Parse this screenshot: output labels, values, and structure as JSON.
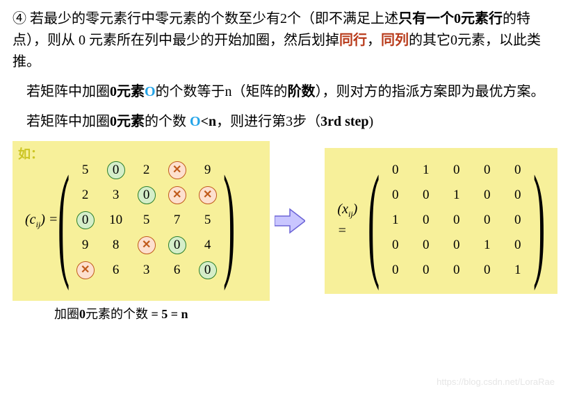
{
  "p1": {
    "num": "④",
    "t1": " 若最少的零元素行中零元素的个数至少有2个（即不满足上述",
    "t2": "只有一个0元素行",
    "t3": "的特点），则从 0 元素所在列中最少的开始加圈，然后划掉",
    "red1": "同行",
    "comma": "，",
    "red2": "同列",
    "t4": "的其它0元素，以此类推。"
  },
  "p2": {
    "indent": "　",
    "t1": "若矩阵中加圈",
    "b0": "0元素",
    "o": "O",
    "t2": "的个数等于n（矩阵的",
    "b1": "阶数",
    "t3": "），则对方的指派方案即为最优方案。"
  },
  "p3": {
    "indent": "　",
    "t1": "若矩阵中加圈",
    "b0": "0元素",
    "t2": "的个数 ",
    "o": "O",
    "lt": "<n",
    "t3": "，则进行第3步（",
    "step": "3rd step",
    "t4": ")"
  },
  "left": {
    "how": "如：",
    "label_pre": "(",
    "label_var": "c",
    "label_sub": "ij",
    "label_post": ") =",
    "cells": [
      {
        "v": "5"
      },
      {
        "v": "0",
        "g": true
      },
      {
        "v": "2"
      },
      {
        "v": "×",
        "x": true
      },
      {
        "v": "9"
      },
      {
        "v": "2"
      },
      {
        "v": "3"
      },
      {
        "v": "0",
        "g": true
      },
      {
        "v": "×",
        "x": true
      },
      {
        "v": "×",
        "x": true
      },
      {
        "v": "0",
        "g": true
      },
      {
        "v": "10"
      },
      {
        "v": "5"
      },
      {
        "v": "7"
      },
      {
        "v": "5"
      },
      {
        "v": "9"
      },
      {
        "v": "8"
      },
      {
        "v": "×",
        "x": true
      },
      {
        "v": "0",
        "g": true
      },
      {
        "v": "4"
      },
      {
        "v": "×",
        "x": true
      },
      {
        "v": "6"
      },
      {
        "v": "3"
      },
      {
        "v": "6"
      },
      {
        "v": "0",
        "g": true
      }
    ]
  },
  "right": {
    "label_pre": "(",
    "label_var": "x",
    "label_sub": "ij",
    "label_post": ") =",
    "cells": [
      "0",
      "1",
      "0",
      "0",
      "0",
      "0",
      "0",
      "1",
      "0",
      "0",
      "1",
      "0",
      "0",
      "0",
      "0",
      "0",
      "0",
      "0",
      "1",
      "0",
      "0",
      "0",
      "0",
      "0",
      "1"
    ]
  },
  "caption": {
    "t1": "加圈",
    "b0": "0",
    "t2": "元素的个数",
    "eq": " = 5 = n"
  },
  "watermark": "https://blog.csdn.net/LoraRae",
  "chart_data": [
    {
      "type": "table",
      "title": "(c_ij) cost matrix with circled/crossed zeros",
      "values": [
        [
          5,
          0,
          2,
          0,
          9
        ],
        [
          2,
          3,
          0,
          0,
          0
        ],
        [
          0,
          10,
          5,
          7,
          5
        ],
        [
          9,
          8,
          0,
          0,
          4
        ],
        [
          0,
          6,
          3,
          6,
          0
        ]
      ],
      "circled_positions": [
        [
          0,
          1
        ],
        [
          1,
          2
        ],
        [
          2,
          0
        ],
        [
          3,
          3
        ],
        [
          4,
          4
        ]
      ],
      "crossed_positions": [
        [
          0,
          3
        ],
        [
          1,
          3
        ],
        [
          1,
          4
        ],
        [
          3,
          2
        ],
        [
          4,
          0
        ]
      ]
    },
    {
      "type": "table",
      "title": "(x_ij) assignment matrix",
      "values": [
        [
          0,
          1,
          0,
          0,
          0
        ],
        [
          0,
          0,
          1,
          0,
          0
        ],
        [
          1,
          0,
          0,
          0,
          0
        ],
        [
          0,
          0,
          0,
          1,
          0
        ],
        [
          0,
          0,
          0,
          0,
          1
        ]
      ]
    }
  ]
}
